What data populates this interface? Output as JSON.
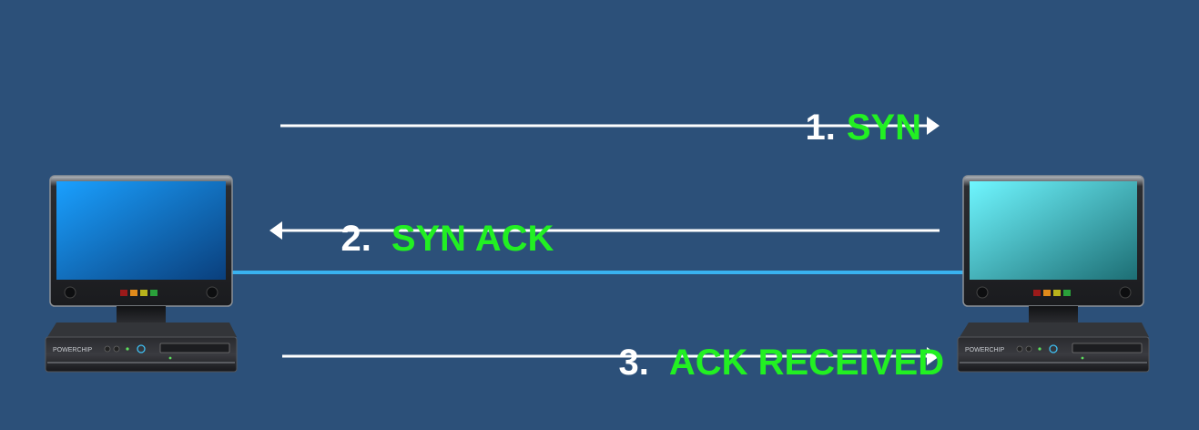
{
  "steps": [
    {
      "number": "1.",
      "text": "SYN",
      "direction": "right"
    },
    {
      "number": "2.",
      "text": "SYN ACK",
      "direction": "left"
    },
    {
      "number": "3.",
      "text": "ACK RECEIVED",
      "direction": "right"
    }
  ],
  "computers": {
    "left": {
      "brand": "POWERCHIP",
      "screen_color_start": "#1aa0ff",
      "screen_color_end": "#0a3f7c"
    },
    "right": {
      "brand": "POWERCHIP",
      "screen_color_start": "#6ff6ff",
      "screen_color_end": "#1d6e74"
    }
  },
  "colors": {
    "background": "#2c5079",
    "label_text": "#22f022",
    "number_text": "#ffffff",
    "arrow": "#ffffff",
    "link_cable": "#39b2f0"
  }
}
